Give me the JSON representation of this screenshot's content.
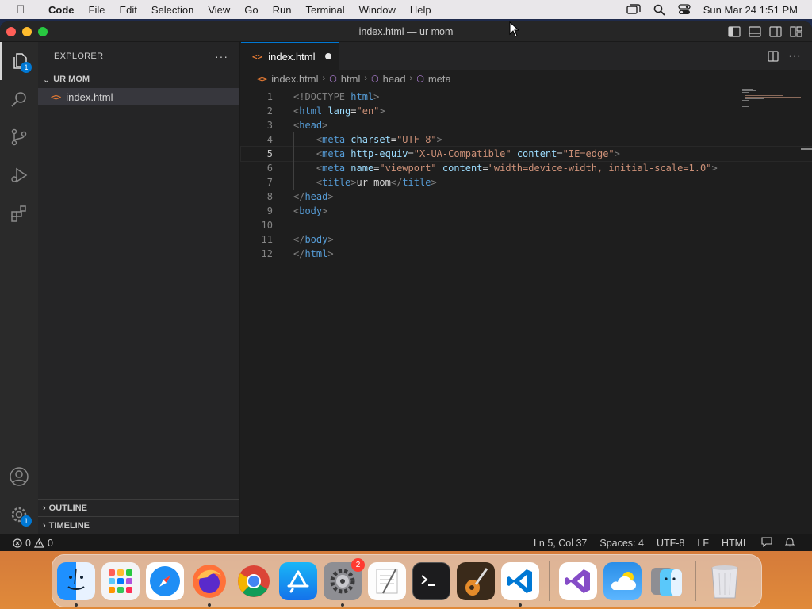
{
  "menubar": {
    "app_name": "Code",
    "items": [
      "File",
      "Edit",
      "Selection",
      "View",
      "Go",
      "Run",
      "Terminal",
      "Window",
      "Help"
    ],
    "datetime": "Sun Mar 24  1:51 PM"
  },
  "window": {
    "title": "index.html — ur mom"
  },
  "activitybar": {
    "explorer_badge": "1",
    "manage_badge": "1"
  },
  "sidebar": {
    "header": "EXPLORER",
    "more": "···",
    "folder": "UR MOM",
    "file": "index.html",
    "outline": "OUTLINE",
    "timeline": "TIMELINE"
  },
  "editor": {
    "tab_label": "index.html",
    "breadcrumb": [
      "index.html",
      "html",
      "head",
      "meta"
    ],
    "line_numbers": [
      "1",
      "2",
      "3",
      "4",
      "5",
      "6",
      "7",
      "8",
      "9",
      "10",
      "11",
      "12"
    ],
    "current_line": "5"
  },
  "code_lines": {
    "l1a": "<!DOCTYPE ",
    "l1b": "html",
    "l1c": ">",
    "l2a": "<",
    "l2b": "html",
    "l2c": " lang",
    "l2d": "=",
    "l2e": "\"en\"",
    "l2f": ">",
    "l3a": "<",
    "l3b": "head",
    "l3c": ">",
    "l4a": "<",
    "l4b": "meta",
    "l4c": " charset",
    "l4d": "=",
    "l4e": "\"UTF-8\"",
    "l4f": ">",
    "l5a": "<",
    "l5b": "meta",
    "l5c": " http-equiv",
    "l5d": "=",
    "l5e": "\"X-UA-Compatible\"",
    "l5f": " content",
    "l5g": "=",
    "l5h": "\"IE=edge\"",
    "l5i": ">",
    "l6a": "<",
    "l6b": "meta",
    "l6c": " name",
    "l6d": "=",
    "l6e": "\"viewport\"",
    "l6f": " content",
    "l6g": "=",
    "l6h": "\"width=device-width, initial-scale=1.0\"",
    "l6i": ">",
    "l7a": "<",
    "l7b": "title",
    "l7c": ">",
    "l7d": "ur mom",
    "l7e": "</",
    "l7f": "title",
    "l7g": ">",
    "l8a": "</",
    "l8b": "head",
    "l8c": ">",
    "l9a": "<",
    "l9b": "body",
    "l9c": ">",
    "l11a": "</",
    "l11b": "body",
    "l11c": ">",
    "l12a": "</",
    "l12b": "html",
    "l12c": ">"
  },
  "statusbar": {
    "errors": "0",
    "warnings": "0",
    "position": "Ln 5, Col 37",
    "spaces": "Spaces: 4",
    "encoding": "UTF-8",
    "eol": "LF",
    "language": "HTML"
  },
  "dock": {
    "apps": [
      "finder",
      "launchpad",
      "safari",
      "firefox",
      "chrome",
      "app-store",
      "system-settings",
      "textedit",
      "terminal",
      "garageband",
      "vscode",
      "visual-studio",
      "weather",
      "migration-assistant",
      "trash"
    ],
    "settings_badge": "2"
  },
  "colors": {
    "accent": "#0078d4",
    "editor_bg": "#1e1e1e",
    "tag": "#569cd6",
    "attribute": "#9cdcfe",
    "string": "#ce9178"
  }
}
